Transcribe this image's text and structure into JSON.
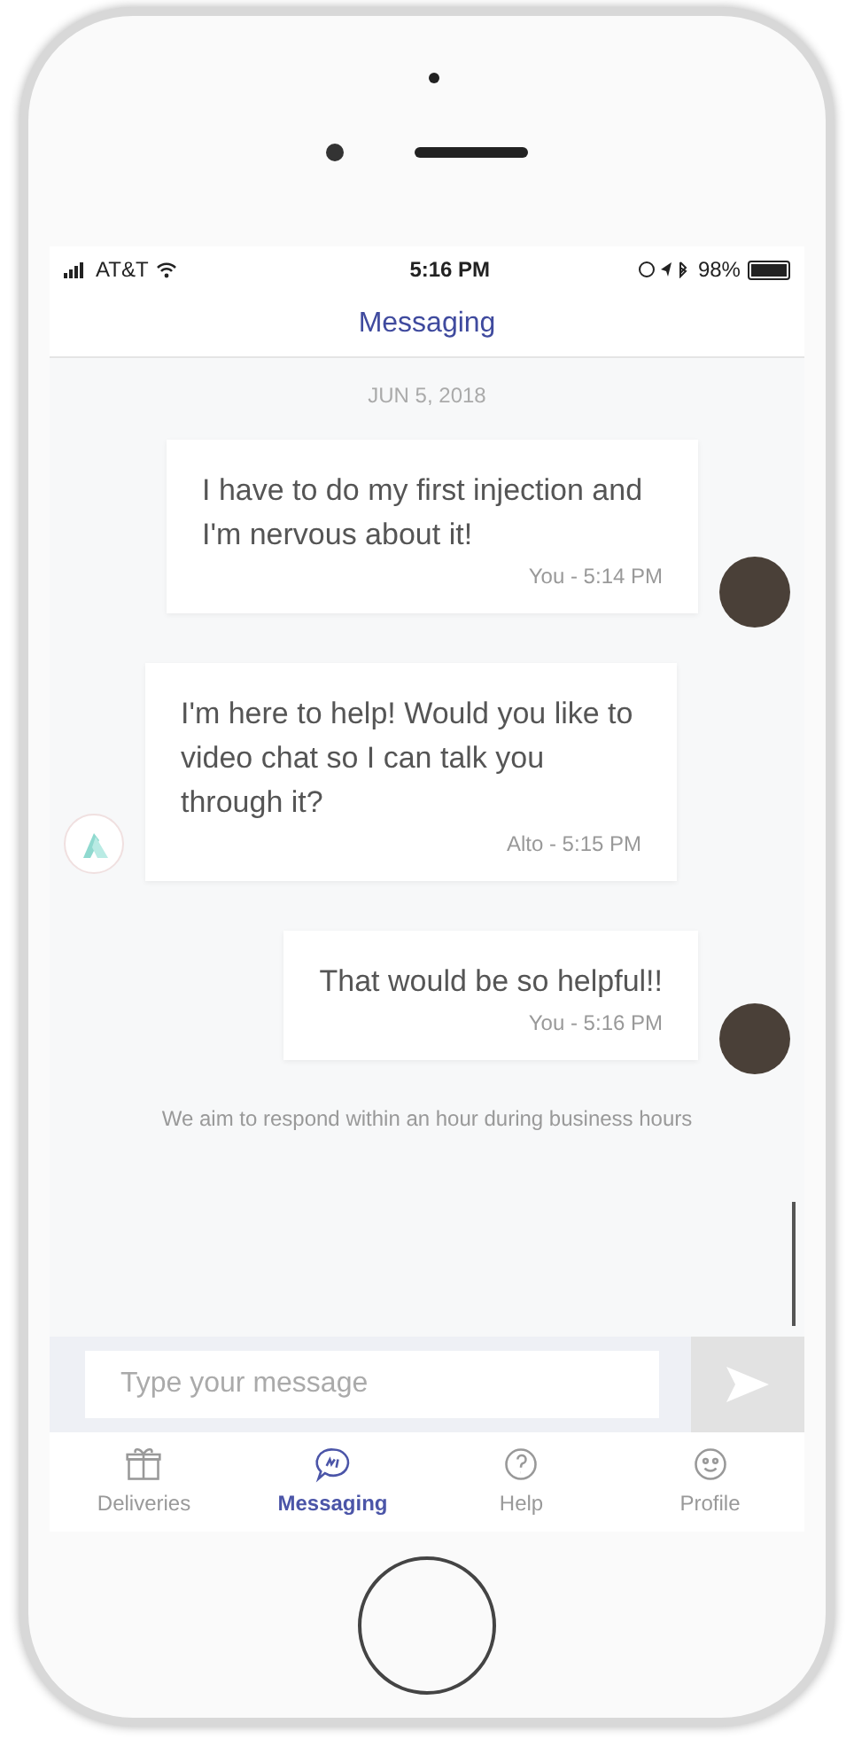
{
  "status_bar": {
    "carrier": "AT&T",
    "time": "5:16 PM",
    "battery": "98%"
  },
  "header": {
    "title": "Messaging"
  },
  "date": "JUN 5, 2018",
  "messages": [
    {
      "kind": "you",
      "text": "I have to do my first injection and I'm nervous about it!",
      "meta": "You - 5:14 PM"
    },
    {
      "kind": "alto",
      "text": "I'm here to help! Would you like to video chat so I can talk you through it?",
      "meta": "Alto - 5:15 PM"
    },
    {
      "kind": "you",
      "text": "That would be so helpful!!",
      "meta": "You - 5:16 PM"
    }
  ],
  "notice": "We aim to respond within an hour during business hours",
  "composer": {
    "placeholder": "Type your message"
  },
  "tabs": [
    {
      "kind": "gift",
      "label": "Deliveries",
      "selected": false
    },
    {
      "kind": "chat",
      "label": "Messaging",
      "selected": true
    },
    {
      "kind": "help",
      "label": "Help",
      "selected": false
    },
    {
      "kind": "smile",
      "label": "Profile",
      "selected": false
    }
  ]
}
